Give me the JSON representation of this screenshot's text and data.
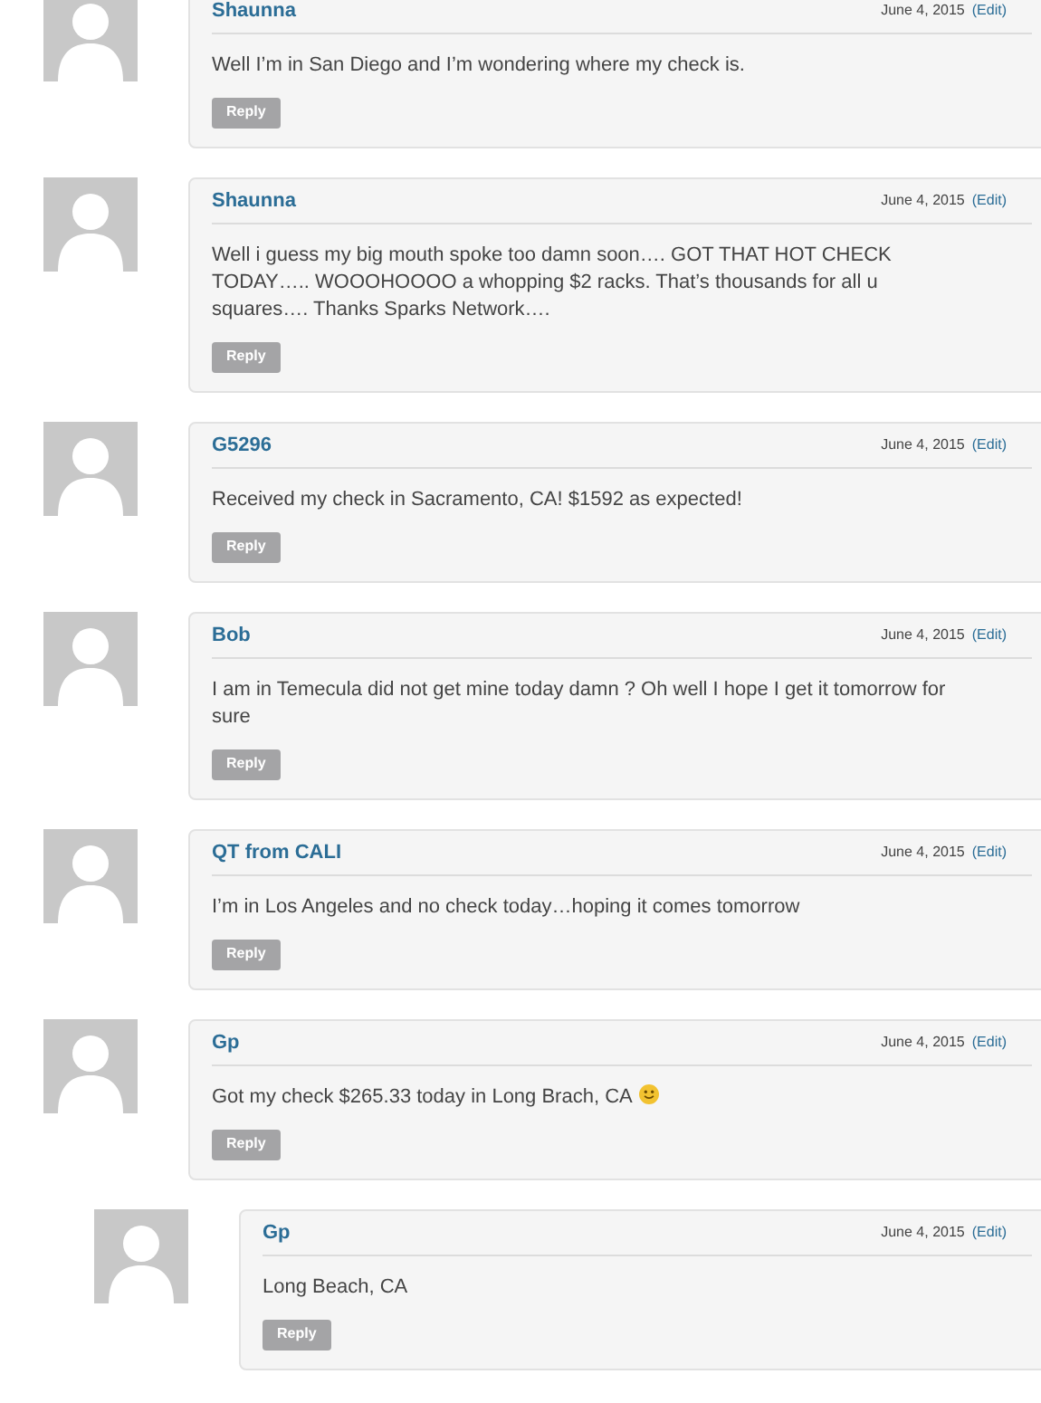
{
  "comments": [
    {
      "author": "Shaunna",
      "date": "June 4, 2015",
      "edit": "(Edit)",
      "text": "Well I’m in San Diego and I’m wondering where my check is.",
      "reply": "Reply"
    },
    {
      "author": "Shaunna",
      "date": "June 4, 2015",
      "edit": "(Edit)",
      "text": "Well i guess my big mouth spoke too damn soon…. GOT THAT HOT CHECK TODAY….. WOOOHOOOO a whopping $2 racks. That’s thousands for all u squares…. Thanks Sparks Network….",
      "reply": "Reply"
    },
    {
      "author": "G5296",
      "date": "June 4, 2015",
      "edit": "(Edit)",
      "text": "Received my check in Sacramento, CA! $1592 as expected!",
      "reply": "Reply"
    },
    {
      "author": "Bob",
      "date": "June 4, 2015",
      "edit": "(Edit)",
      "text": "I am in Temecula did not get mine today damn ? Oh well I hope I get it tomorrow for sure",
      "reply": "Reply"
    },
    {
      "author": "QT from CALI",
      "date": "June 4, 2015",
      "edit": "(Edit)",
      "text": "I’m in Los Angeles and no check today…hoping it comes tomorrow",
      "reply": "Reply"
    },
    {
      "author": "Gp",
      "date": "June 4, 2015",
      "edit": "(Edit)",
      "text": "Got my check $265.33 today in Long Brach, CA",
      "smiley": true,
      "reply": "Reply",
      "children": [
        {
          "author": "Gp",
          "date": "June 4, 2015",
          "edit": "(Edit)",
          "text": "Long Beach, CA",
          "reply": "Reply"
        }
      ]
    }
  ]
}
